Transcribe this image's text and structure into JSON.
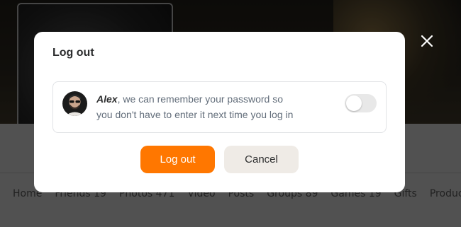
{
  "background": {
    "nav_items": [
      "Home",
      "Friends 19",
      "Photos 471",
      "Video",
      "Posts",
      "Groups 89",
      "Games 19",
      "Gifts",
      "Products"
    ]
  },
  "modal": {
    "title": "Log out",
    "user_name": "Alex",
    "remember_message": ", we can remember your password so you don't have to enter it next time you log in",
    "remember_toggle_on": false,
    "logout_label": "Log out",
    "cancel_label": "Cancel"
  },
  "colors": {
    "accent": "#ff7700",
    "cancel_bg": "#efebe6",
    "toggle_off": "#e8e8e8"
  },
  "icons": {
    "close": "close-icon"
  }
}
